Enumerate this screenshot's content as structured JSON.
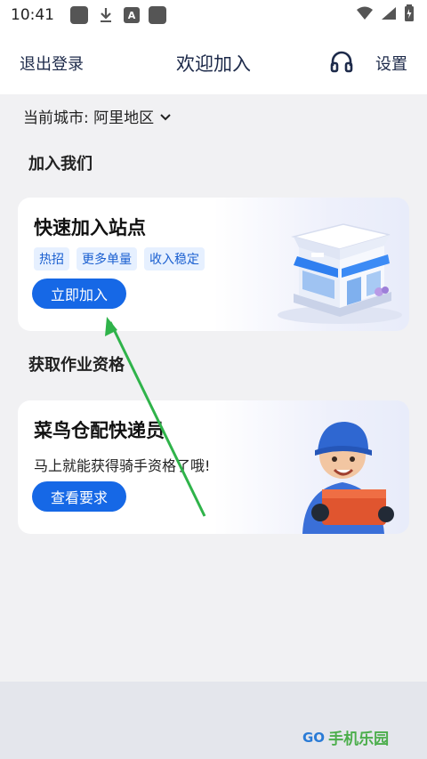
{
  "status_bar": {
    "time": "10:41"
  },
  "header": {
    "left_label": "退出登录",
    "title": "欢迎加入",
    "right_label": "设置"
  },
  "city": {
    "label": "当前城市: 阿里地区"
  },
  "sections": {
    "join_title": "加入我们",
    "qualify_title": "获取作业资格"
  },
  "card_station": {
    "title": "快速加入站点",
    "tags": [
      "热招",
      "更多单量",
      "收入稳定"
    ],
    "button": "立即加入"
  },
  "card_courier": {
    "title": "菜鸟仓配快递员",
    "subtitle": "马上就能获得骑手资格了哦!",
    "button": "查看要求"
  },
  "watermark": {
    "logo": "GO",
    "text": "手机乐园"
  },
  "colors": {
    "accent": "#1668e6",
    "tag_bg": "#e6f0ff",
    "tag_text": "#1a5fd0",
    "annotation_arrow": "#2fb34a"
  }
}
